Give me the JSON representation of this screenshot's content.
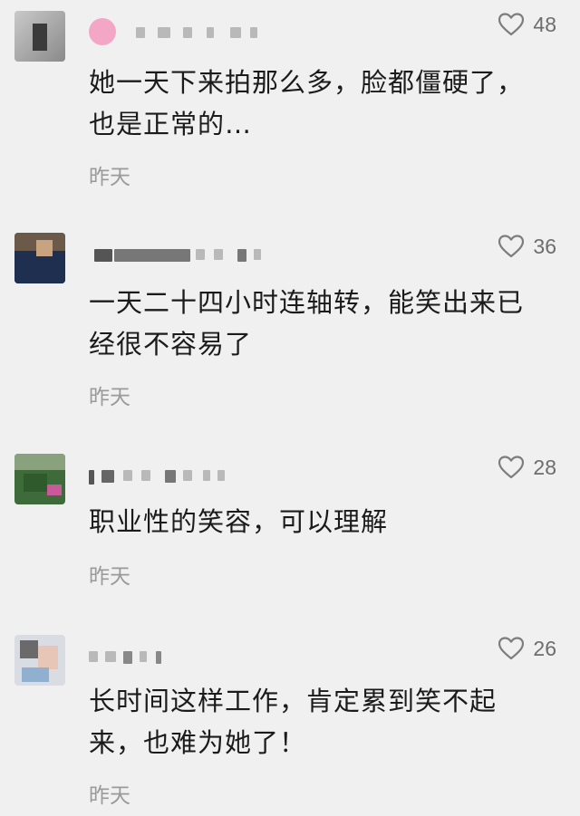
{
  "comments": [
    {
      "likes": "48",
      "text": "她一天下来拍那么多，脸都僵硬了，\n也是正常的…",
      "time": "昨天"
    },
    {
      "likes": "36",
      "text": "一天二十四小时连轴转，能笑出来已\n经很不容易了",
      "time": "昨天"
    },
    {
      "likes": "28",
      "text": "职业性的笑容，可以理解",
      "time": "昨天"
    },
    {
      "likes": "26",
      "text": "长时间这样工作，肯定累到笑不起\n来，也难为她了！",
      "time": "昨天"
    }
  ],
  "icons": {
    "like": "heart-outline-icon"
  },
  "colors": {
    "background": "#f0f0f0",
    "like_icon": "#7d7d7d",
    "time": "#9a9a9a"
  }
}
